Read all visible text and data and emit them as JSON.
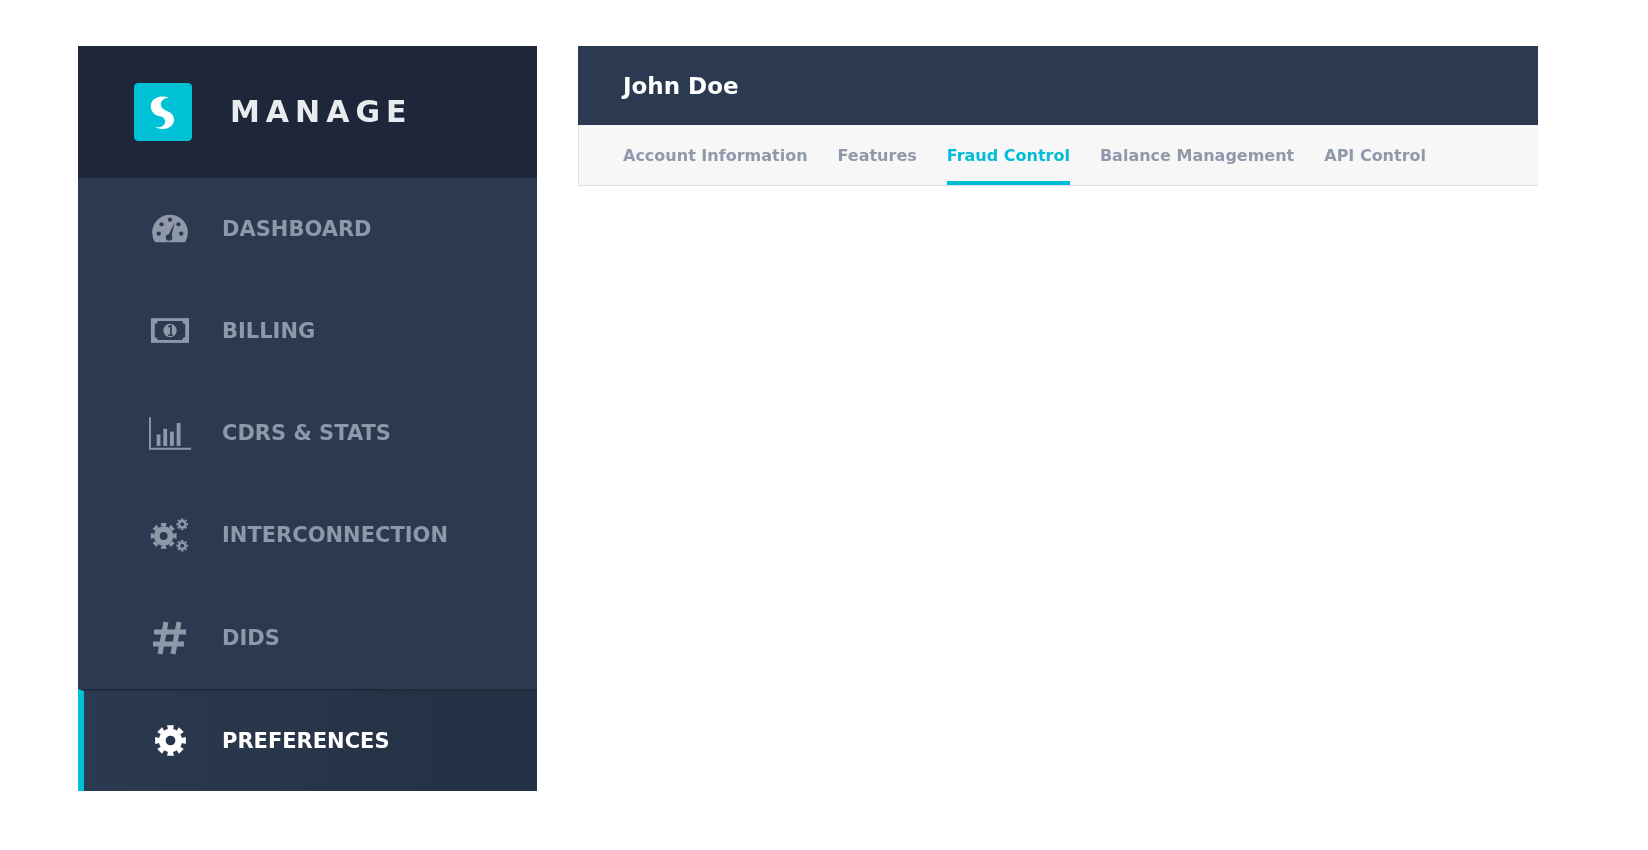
{
  "sidebar": {
    "brand": "MANAGE",
    "items": [
      {
        "label": "DASHBOARD",
        "selected": false
      },
      {
        "label": "BILLING",
        "selected": false
      },
      {
        "label": "CDRS & STATS",
        "selected": false
      },
      {
        "label": "INTERCONNECTION",
        "selected": false
      },
      {
        "label": "DIDS",
        "selected": false
      },
      {
        "label": "PREFERENCES",
        "selected": true
      }
    ]
  },
  "header": {
    "title": "John Doe"
  },
  "tabs": [
    {
      "label": "Account Information",
      "selected": false
    },
    {
      "label": "Features",
      "selected": false
    },
    {
      "label": "Fraud Control",
      "selected": true
    },
    {
      "label": "Balance Management",
      "selected": false
    },
    {
      "label": "API Control",
      "selected": false
    }
  ]
}
